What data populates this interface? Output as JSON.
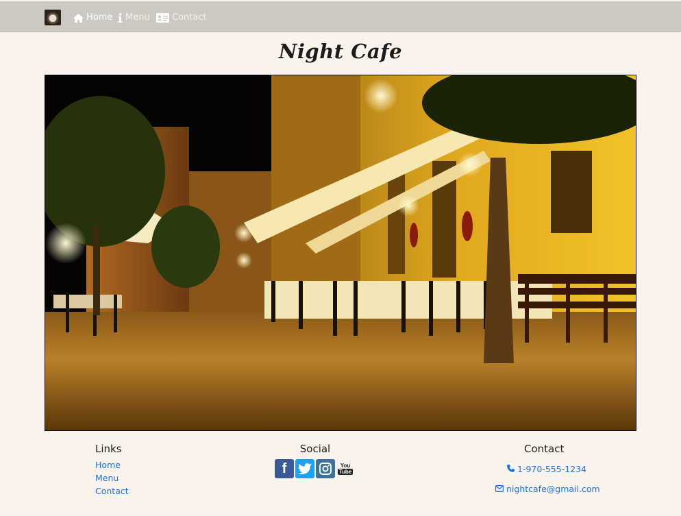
{
  "nav": {
    "brand_icon": "coffee-cup-logo",
    "items": [
      {
        "label": "Home",
        "icon": "home-icon",
        "active": true
      },
      {
        "label": "Menu",
        "icon": "info-icon",
        "active": false
      },
      {
        "label": "Contact",
        "icon": "address-card-icon",
        "active": false
      }
    ]
  },
  "page": {
    "title": "Night Cafe"
  },
  "footer": {
    "links": {
      "heading": "Links",
      "items": [
        "Home",
        "Menu",
        "Contact"
      ]
    },
    "social": {
      "heading": "Social",
      "icons": [
        "facebook-icon",
        "twitter-icon",
        "instagram-icon",
        "youtube-icon"
      ]
    },
    "contact": {
      "heading": "Contact",
      "phone": "1-970-555-1234",
      "email": "nightcafe@gmail.com"
    }
  },
  "colors": {
    "navbar": "#ccc9c3",
    "background": "#f9f3ec",
    "link": "#1a73e8",
    "facebook": "#3b5998",
    "twitter": "#1da1f2",
    "instagram": "#3f729b"
  }
}
